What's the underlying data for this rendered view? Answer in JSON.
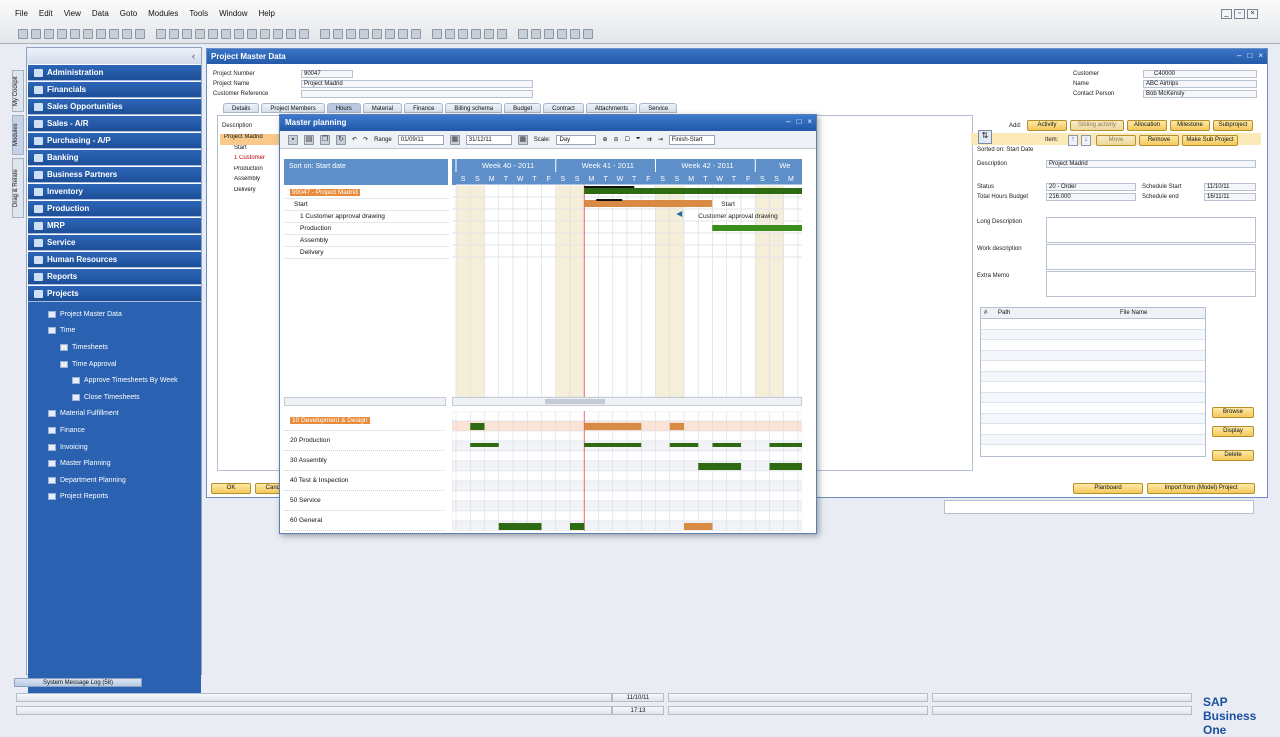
{
  "menu": [
    "File",
    "Edit",
    "View",
    "Data",
    "Goto",
    "Modules",
    "Tools",
    "Window",
    "Help"
  ],
  "side_tabs": [
    "My Cockpit",
    "Modules",
    "Drag & Relate"
  ],
  "modules": [
    "Administration",
    "Financials",
    "Sales Opportunities",
    "Sales - A/R",
    "Purchasing - A/P",
    "Banking",
    "Business Partners",
    "Inventory",
    "Production",
    "MRP",
    "Service",
    "Human Resources",
    "Reports",
    "Projects"
  ],
  "submenu": [
    {
      "label": "Project Master Data",
      "indent": 0
    },
    {
      "label": "Time",
      "indent": 0
    },
    {
      "label": "Timesheets",
      "indent": 1
    },
    {
      "label": "Time Approval",
      "indent": 1
    },
    {
      "label": "Approve Timesheets By Week",
      "indent": 2
    },
    {
      "label": "Close Timesheets",
      "indent": 2
    },
    {
      "label": "Material Fulfillment",
      "indent": 0
    },
    {
      "label": "Finance",
      "indent": 0
    },
    {
      "label": "Invoicing",
      "indent": 0
    },
    {
      "label": "Master Planning",
      "indent": 0
    },
    {
      "label": "Department Planning",
      "indent": 0
    },
    {
      "label": "Project Reports",
      "indent": 0
    }
  ],
  "pmd": {
    "title": "Project Master Data",
    "project_number_label": "Project Number",
    "project_number": "90047",
    "project_name_label": "Project Name",
    "project_name": "Project Madrid",
    "customer_reference_label": "Customer Reference",
    "customer_reference": "",
    "customer_label": "Customer",
    "customer": "C40000",
    "name_label": "Name",
    "name": "ABC Airtrips",
    "contact_label": "Contact Person",
    "contact": "Bob McKensly",
    "tabs": [
      "Details",
      "Project Members",
      "Hours",
      "Material",
      "Finance",
      "Billing schema",
      "Budget",
      "Contract",
      "Attachments",
      "Service"
    ],
    "active_tab": "Hours",
    "description_col": "Description",
    "tree": [
      "Project Madrid",
      "Start",
      "1 Customer",
      "Production",
      "Assembly",
      "Delivery"
    ],
    "ok": "OK",
    "cancel": "Cancel",
    "planboard": "Planboard",
    "import": "Import from (Model) Project"
  },
  "right": {
    "add_label": "Add:",
    "item_label": "Item:",
    "buttons_row1": [
      "Activity",
      "Sibling activity",
      "Allocation",
      "Milestone",
      "Subproject"
    ],
    "buttons_row2": [
      "Move",
      "Remove",
      "Make Sub Project"
    ],
    "sorted": "Sorted on: Start Date",
    "description_label": "Description",
    "description": "Project Madrid",
    "status_label": "Status",
    "status": "20 - Order",
    "total_hours_label": "Total Hours Budget",
    "total_hours": "216.000",
    "schedule_start_label": "Schedule Start",
    "schedule_start": "11/10/11",
    "schedule_end_label": "Schedule end",
    "schedule_end": "16/11/11",
    "long_desc_label": "Long Description",
    "work_desc_label": "Work description",
    "extra_memo_label": "Extra Memo",
    "att_cols": [
      "#",
      "Path",
      "File Name"
    ],
    "browse": "Browse",
    "display": "Display",
    "delete": "Delete"
  },
  "mp": {
    "title": "Master planning",
    "range_label": "Range",
    "range_from": "01/09/11",
    "range_to": "31/12/11",
    "scale_label": "Scale:",
    "scale": "Day",
    "dependency": "Finish-Start",
    "sort_label": "Sort on: Start date",
    "weeks": [
      "Week 40 - 2011",
      "Week 41 - 2011",
      "Week 42 - 2011",
      "We"
    ],
    "days": [
      "S",
      "S",
      "M",
      "T",
      "W",
      "T",
      "F",
      "S",
      "S",
      "M",
      "T",
      "W",
      "T",
      "F",
      "S",
      "S",
      "M",
      "T",
      "W",
      "T",
      "F",
      "S",
      "S",
      "M",
      "T"
    ],
    "tree": [
      "90047 - Project Madrid",
      "Start",
      "1 Customer approval drawing",
      "Production",
      "Assembly",
      "Delivery"
    ],
    "bar_labels": [
      "Start",
      "Customer approval drawing"
    ],
    "departments": [
      "10 Development & Design",
      "20 Production",
      "30 Assembly",
      "40 Test & Inspection",
      "50 Service",
      "60 General"
    ]
  },
  "status": {
    "log": "System Message Log (58)",
    "date": "11/10/11",
    "time": "17:13",
    "logo": "SAP Business One"
  }
}
